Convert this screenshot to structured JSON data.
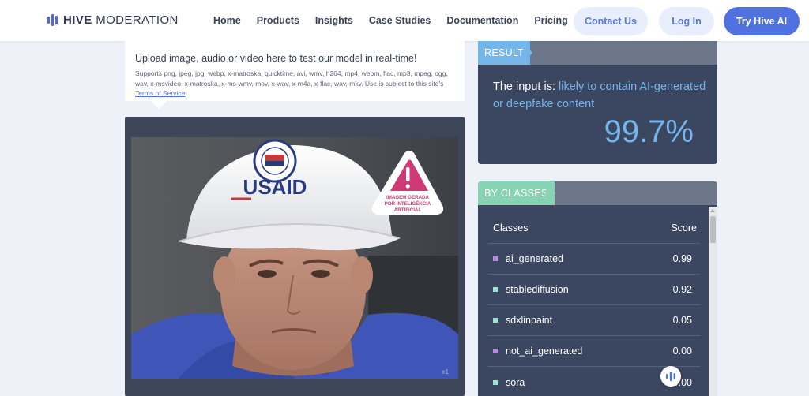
{
  "header": {
    "logo_bold": "HIVE",
    "logo_rest": "MODERATION",
    "nav": [
      "Home",
      "Products",
      "Insights",
      "Case Studies",
      "Documentation",
      "Pricing"
    ],
    "contact_label": "Contact Us",
    "login_label": "Log In",
    "try_label": "Try Hive AI"
  },
  "upload": {
    "title": "Upload image, audio or video here to test our model in real-time!",
    "desc": "Supports png, jpeg, jpg, webp, x-matroska, quicktime, avi, wmv, h264, mp4, webm, flac, mp3, mpeg, ogg, wav, x-msvideo, x-matroska, x-ms-wmv, mov, x-wav, x-m4a, x-flac, wav, mkv. Use is subject to this site's ",
    "tos_link": "Terms of Service",
    "tos_after": "."
  },
  "image": {
    "cap_text": "USAID",
    "warning_lines": [
      "IMAGEM GERADA",
      "POR INTELIGÊNCIA",
      "ARTIFICIAL"
    ],
    "watermark": "x1"
  },
  "result": {
    "tag": "RESULT",
    "prefix": "The input is: ",
    "verdict": "likely to contain AI-generated or deepfake content",
    "percent": "99.7%"
  },
  "classes": {
    "tag": "BY CLASSES",
    "col_class": "Classes",
    "col_score": "Score",
    "rows": [
      {
        "name": "ai_generated",
        "score": "0.99",
        "color": "#b98bdd"
      },
      {
        "name": "stablediffusion",
        "score": "0.92",
        "color": "#9fe3d2"
      },
      {
        "name": "sdxlinpaint",
        "score": "0.05",
        "color": "#9fe3d2"
      },
      {
        "name": "not_ai_generated",
        "score": "0.00",
        "color": "#b98bdd"
      },
      {
        "name": "sora",
        "score": "0.00",
        "color": "#9fe3d2"
      }
    ]
  },
  "colors": {
    "accent": "#4f72e0",
    "result_highlight": "#74b5ea",
    "card_bg": "#3b4660"
  }
}
